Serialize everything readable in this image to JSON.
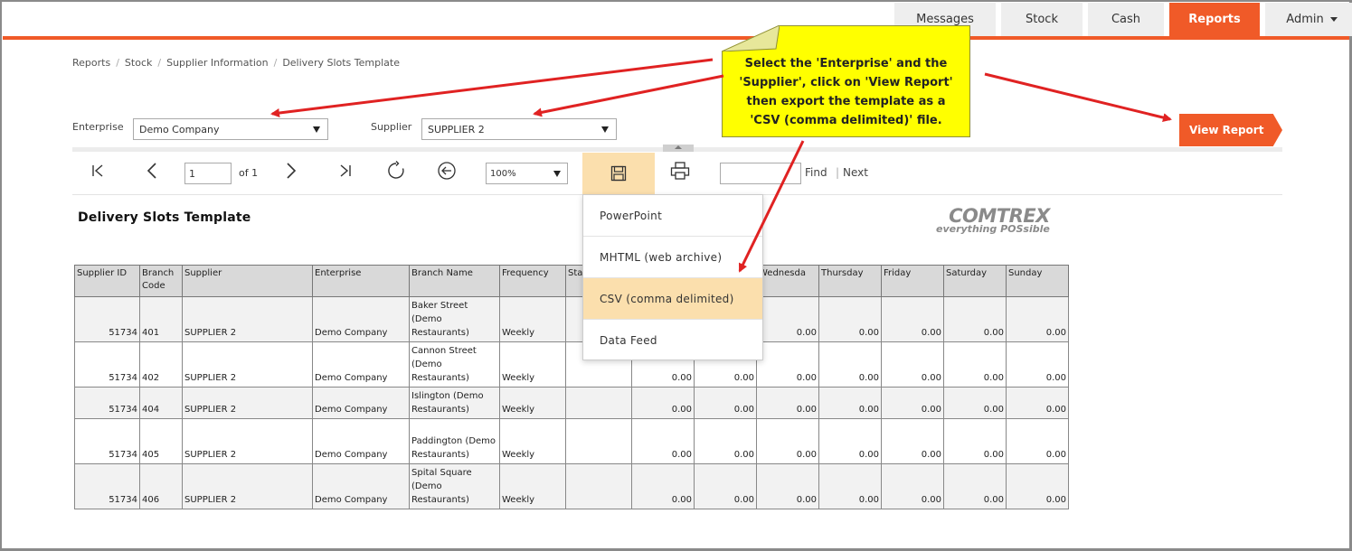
{
  "nav": {
    "tabs": [
      {
        "label": "Messages"
      },
      {
        "label": "Stock"
      },
      {
        "label": "Cash"
      },
      {
        "label": "Reports"
      },
      {
        "label": "Admin"
      }
    ],
    "active": "Reports"
  },
  "breadcrumb": [
    "Reports",
    "Stock",
    "Supplier Information",
    "Delivery Slots Template"
  ],
  "filters": {
    "enterprise_label": "Enterprise",
    "enterprise_value": "Demo Company",
    "supplier_label": "Supplier",
    "supplier_value": "SUPPLIER 2",
    "view_report_label": "View Report"
  },
  "toolbar": {
    "page_value": "1",
    "of_text": "of 1",
    "zoom_value": "100%",
    "find_value": "",
    "find_label": "Find",
    "find_sep": "|",
    "next_label": "Next"
  },
  "export_menu": {
    "items": [
      "PowerPoint",
      "MHTML (web archive)",
      "CSV (comma delimited)",
      "Data Feed"
    ],
    "highlighted": "CSV (comma delimited)"
  },
  "report": {
    "title": "Delivery Slots Template",
    "logo_brand": "COMTREX",
    "logo_tagline": "everything POSsible",
    "columns": [
      "Supplier ID",
      "Branch Code",
      "Supplier",
      "Enterprise",
      "Branch Name",
      "Frequency",
      "Sta",
      "",
      "",
      "Wednesda",
      "Thursday",
      "Friday",
      "Saturday",
      "Sunday"
    ],
    "rows": [
      {
        "supplier_id": "51734",
        "branch_code": "401",
        "supplier": "SUPPLIER 2",
        "enterprise": "Demo Company",
        "branch_name": "Baker Street (Demo Restaurants)",
        "frequency": "Weekly",
        "start": "",
        "mon": "",
        "tue": "",
        "wed": "0.00",
        "thu": "0.00",
        "fri": "0.00",
        "sat": "0.00",
        "sun": "0.00"
      },
      {
        "supplier_id": "51734",
        "branch_code": "402",
        "supplier": "SUPPLIER 2",
        "enterprise": "Demo Company",
        "branch_name": "Cannon Street (Demo Restaurants)",
        "frequency": "Weekly",
        "start": "",
        "mon": "0.00",
        "tue": "0.00",
        "wed": "0.00",
        "thu": "0.00",
        "fri": "0.00",
        "sat": "0.00",
        "sun": "0.00"
      },
      {
        "supplier_id": "51734",
        "branch_code": "404",
        "supplier": "SUPPLIER 2",
        "enterprise": "Demo Company",
        "branch_name": "Islington (Demo Restaurants)",
        "frequency": "Weekly",
        "start": "",
        "mon": "0.00",
        "tue": "0.00",
        "wed": "0.00",
        "thu": "0.00",
        "fri": "0.00",
        "sat": "0.00",
        "sun": "0.00"
      },
      {
        "supplier_id": "51734",
        "branch_code": "405",
        "supplier": "SUPPLIER 2",
        "enterprise": "Demo Company",
        "branch_name": "Paddington (Demo Restaurants)",
        "frequency": "Weekly",
        "start": "",
        "mon": "0.00",
        "tue": "0.00",
        "wed": "0.00",
        "thu": "0.00",
        "fri": "0.00",
        "sat": "0.00",
        "sun": "0.00"
      },
      {
        "supplier_id": "51734",
        "branch_code": "406",
        "supplier": "SUPPLIER 2",
        "enterprise": "Demo Company",
        "branch_name": "Spital Square (Demo Restaurants)",
        "frequency": "Weekly",
        "start": "",
        "mon": "0.00",
        "tue": "0.00",
        "wed": "0.00",
        "thu": "0.00",
        "fri": "0.00",
        "sat": "0.00",
        "sun": "0.00"
      }
    ]
  },
  "callout": {
    "text": "Select the 'Enterprise' and the 'Supplier', click on 'View Report' then export the template as a 'CSV (comma delimited)' file."
  },
  "colors": {
    "accent": "#f05a28",
    "highlight": "#fbdfad",
    "callout": "#ffff00",
    "arrow": "#e02222"
  },
  "icons": [
    "first-page-icon",
    "prev-page-icon",
    "next-page-icon",
    "last-page-icon",
    "refresh-icon",
    "back-icon",
    "save-icon",
    "print-icon",
    "caret-down-icon"
  ]
}
